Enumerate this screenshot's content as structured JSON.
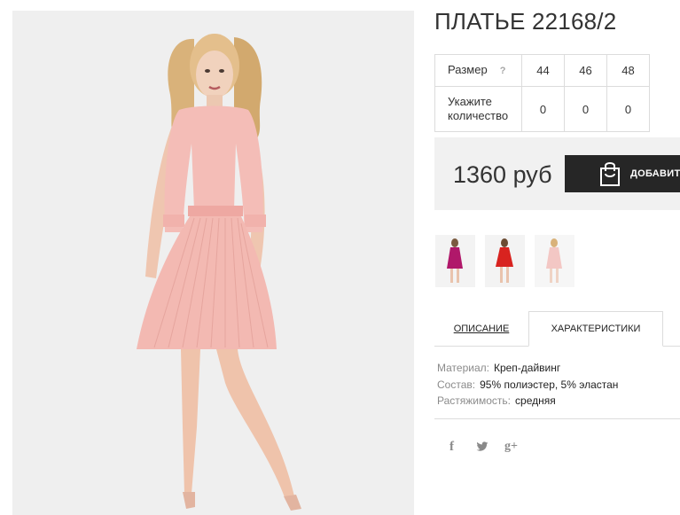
{
  "product": {
    "title": "ПЛАТЬЕ 22168/2",
    "photo_icon": "dress-model-photo"
  },
  "size_table": {
    "size_label": "Размер",
    "help_icon": "?",
    "qty_label": "Укажите количество",
    "sizes": [
      "44",
      "46",
      "48"
    ],
    "quantities": [
      "0",
      "0",
      "0"
    ]
  },
  "price": {
    "value": "1360 руб",
    "add_button_label": "ДОБАВИТЬ",
    "add_button_icon": "shopping-bag-icon"
  },
  "thumbnails": [
    {
      "icon": "dress-thumb-magenta",
      "color": "#b0186a"
    },
    {
      "icon": "dress-thumb-red",
      "color": "#d8231f"
    },
    {
      "icon": "dress-thumb-pink",
      "color": "#f3c7c4"
    }
  ],
  "tabs": {
    "description": "ОПИСАНИЕ",
    "characteristics": "ХАРАКТЕРИСТИКИ"
  },
  "specs": [
    {
      "key": "Материал:",
      "value": "Креп-дайвинг"
    },
    {
      "key": "Состав:",
      "value": "95% полиэстер, 5% эластан"
    },
    {
      "key": "Растяжимость:",
      "value": "средняя"
    }
  ],
  "social": {
    "facebook": "f",
    "twitter": "twitter-icon",
    "googleplus": "g+"
  },
  "colors": {
    "dress": "#f4bdb7",
    "dark_button": "#262626",
    "price_bg": "#f1f1f1"
  }
}
